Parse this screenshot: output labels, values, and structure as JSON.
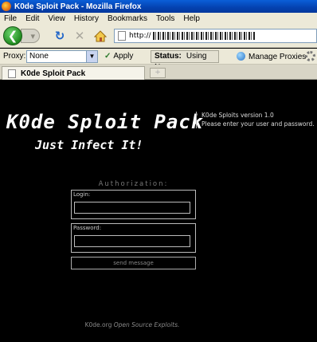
{
  "window": {
    "title": "K0de Sploit Pack - Mozilla Firefox"
  },
  "menu": {
    "items": [
      "File",
      "Edit",
      "View",
      "History",
      "Bookmarks",
      "Tools",
      "Help"
    ]
  },
  "navbar": {
    "url_prefix": "http://"
  },
  "proxybar": {
    "label": "Proxy:",
    "selected": "None",
    "apply_label": "Apply",
    "status_label": "Status:",
    "status_value": "Using None",
    "manage_label": "Manage Proxies"
  },
  "tabs": {
    "active_title": "K0de Sploit Pack",
    "new_tab_symbol": "+"
  },
  "page": {
    "logo": "K0de Sploit Pack",
    "tagline": "Just Infect It!",
    "info_line1": "K0de Sploits version 1.0",
    "info_line2": "Please enter your user and password.",
    "auth_title": "Authorization:",
    "login_label": "Login:",
    "password_label": "Password:",
    "send_label": "send message",
    "footer_prefix": "K0de.org",
    "footer_suffix": "Open Source Exploits."
  },
  "colors": {
    "page_background": "#000000",
    "titlebar": "#0441b0",
    "chrome": "#ece9d8"
  }
}
